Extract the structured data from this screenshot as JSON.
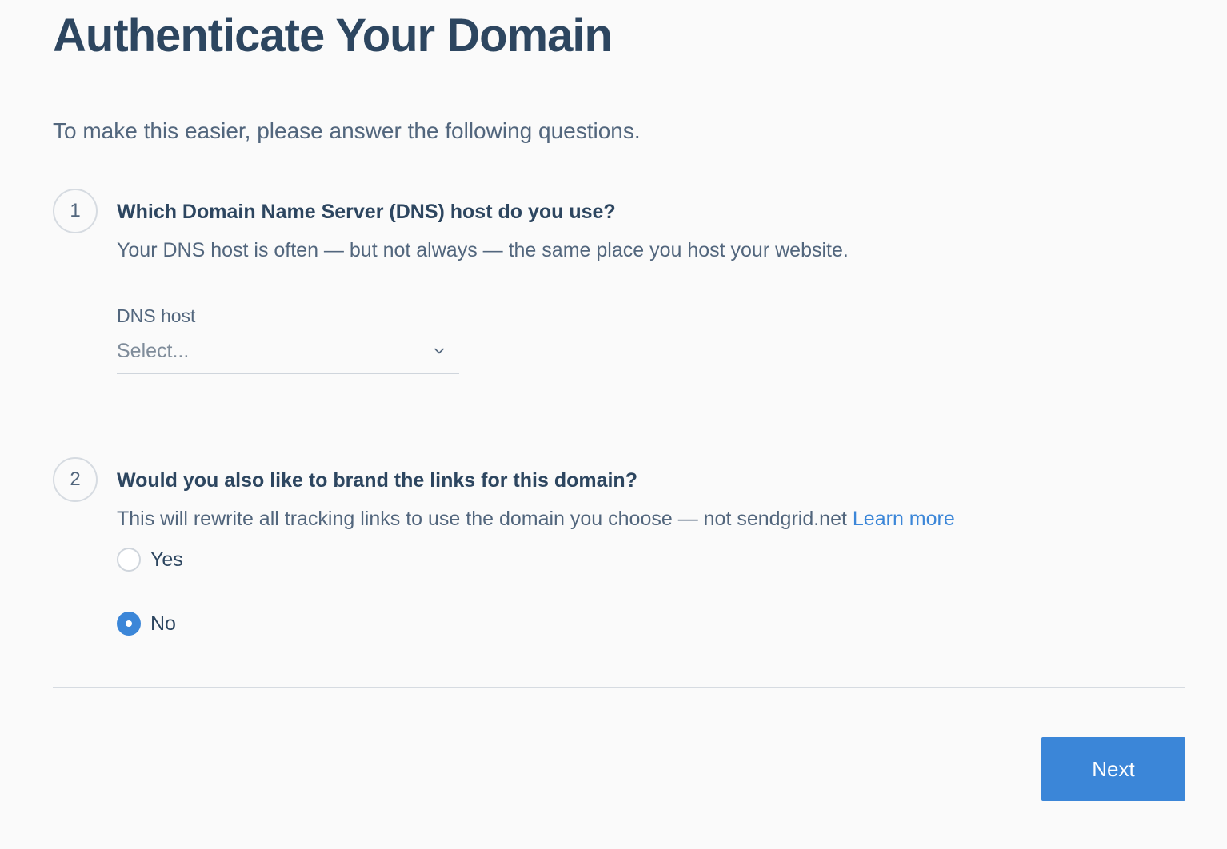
{
  "page": {
    "title": "Authenticate Your Domain",
    "intro": "To make this easier, please answer the following questions."
  },
  "steps": [
    {
      "number": "1",
      "title": "Which Domain Name Server (DNS) host do you use?",
      "description": "Your DNS host is often — but not always — the same place you host your website.",
      "field": {
        "label": "DNS host",
        "placeholder": "Select...",
        "icon": "chevron-down-icon"
      }
    },
    {
      "number": "2",
      "title": "Would you also like to brand the links for this domain?",
      "description": "This will rewrite all tracking links to use the domain you choose — not sendgrid.net",
      "link_label": "Learn more",
      "options": [
        {
          "label": "Yes",
          "selected": false
        },
        {
          "label": "No",
          "selected": true
        }
      ]
    }
  ],
  "footer": {
    "next_label": "Next"
  },
  "colors": {
    "primary": "#3b86d8",
    "heading": "#2d4660",
    "text": "#52667d",
    "background": "#fafafa"
  }
}
